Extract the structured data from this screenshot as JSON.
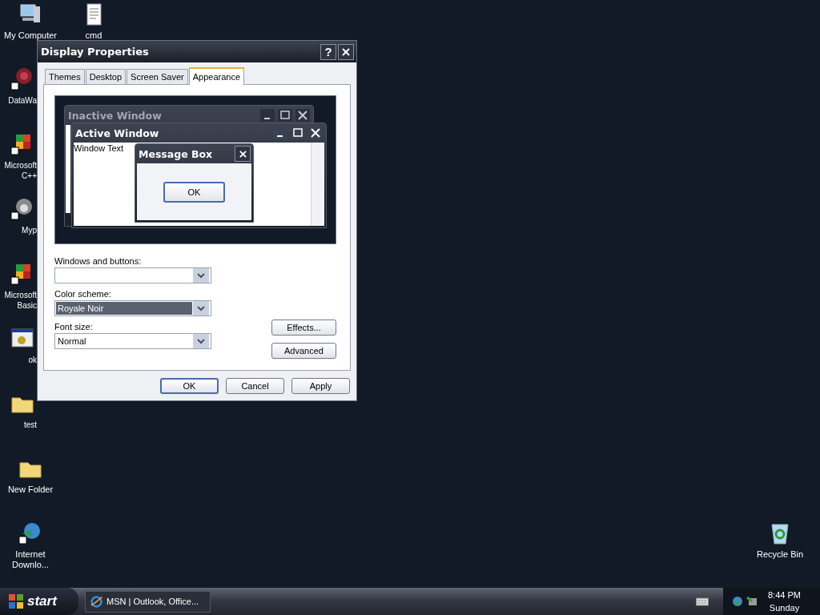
{
  "desktop": {
    "left_column": [
      {
        "label": "My Computer",
        "kind": "computer",
        "shortcut": false
      },
      {
        "label": "DataWa",
        "kind": "pattern",
        "shortcut": true
      },
      {
        "label": "Microsoft C++",
        "kind": "app",
        "shortcut": true
      },
      {
        "label": "Myp",
        "kind": "raccoon",
        "shortcut": true
      },
      {
        "label": "Microsoft Basic",
        "kind": "app",
        "shortcut": true
      },
      {
        "label": "ok",
        "kind": "window",
        "shortcut": false
      },
      {
        "label": "test",
        "kind": "folder",
        "shortcut": false
      },
      {
        "label": "New Folder",
        "kind": "folder",
        "shortcut": false
      },
      {
        "label": "Internet Downlo...",
        "kind": "globe",
        "shortcut": true
      }
    ],
    "second_column": [
      {
        "label": "cmd"
      }
    ],
    "right_column": [
      {
        "label": "Recycle Bin"
      }
    ]
  },
  "dialog": {
    "title": "Display Properties",
    "help": "?",
    "tabs": [
      {
        "label": "Themes",
        "selected": false
      },
      {
        "label": "Desktop",
        "selected": false
      },
      {
        "label": "Screen Saver",
        "selected": false
      },
      {
        "label": "Appearance",
        "selected": true
      }
    ],
    "preview": {
      "inactive_title": "Inactive Window",
      "active_title": "Active Window",
      "window_text": "Window Text",
      "message_box_title": "Message Box",
      "message_box_button": "OK"
    },
    "fields": [
      {
        "label": "Windows and buttons:",
        "selected": false
      },
      {
        "label": "Color scheme:",
        "value": "Royale Noir",
        "selected": true
      },
      {
        "label": "Font size:",
        "value": "Normal",
        "selected": false
      }
    ],
    "side_buttons": [
      "Effects...",
      "Advanced"
    ],
    "buttons": [
      {
        "label": "OK",
        "default": true
      },
      {
        "label": "Cancel",
        "default": false
      },
      {
        "label": "Apply",
        "default": false
      }
    ]
  },
  "taskbar": {
    "start": "start",
    "tasks": [
      {
        "label": "MSN | Outlook, Office..."
      }
    ],
    "time": "8:44 PM",
    "day": "Sunday"
  }
}
